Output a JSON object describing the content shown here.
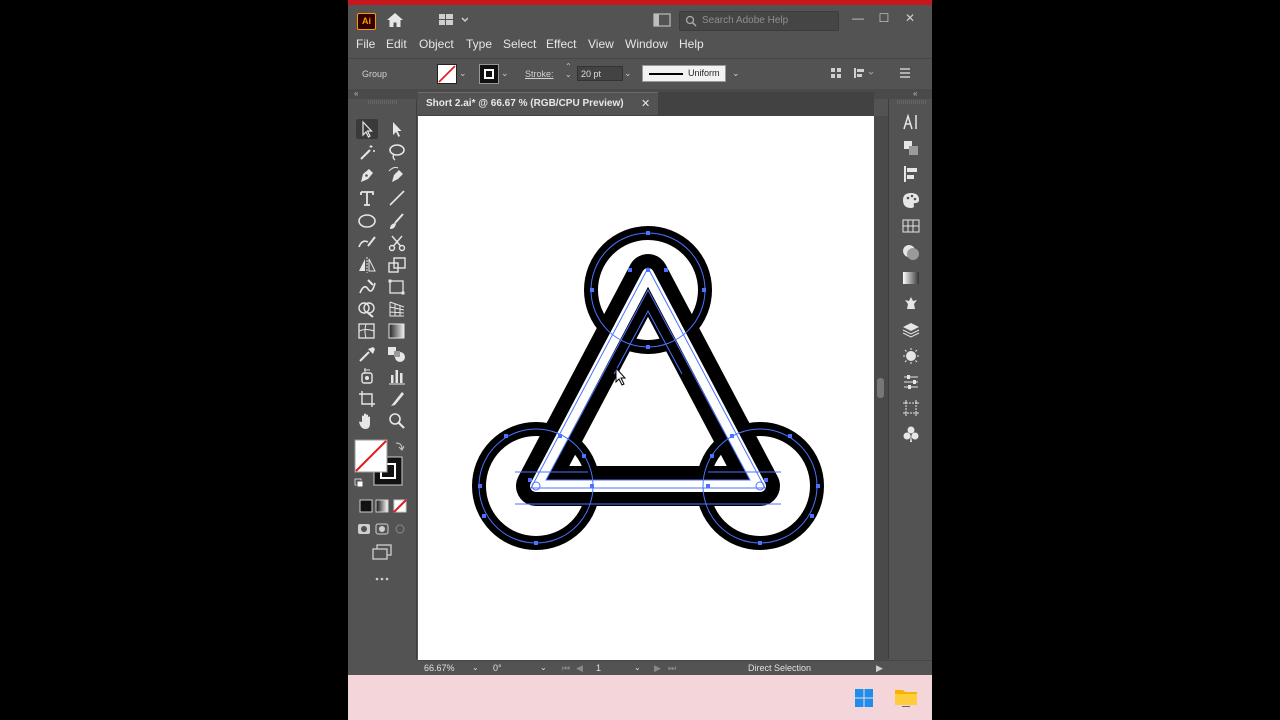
{
  "app": {
    "logo_text": "Ai",
    "search_placeholder": "Search Adobe Help",
    "window_buttons": [
      "—",
      "☐",
      "✕"
    ]
  },
  "menu": [
    "File",
    "Edit",
    "Object",
    "Type",
    "Select",
    "Effect",
    "View",
    "Window",
    "Help"
  ],
  "control_bar": {
    "selection_type": "Group",
    "stroke_label": "Stroke:",
    "stroke_value": "20 pt",
    "profile_label": "Uniform"
  },
  "ribbon": {
    "left_collapse": "«",
    "right_collapse": "«"
  },
  "document": {
    "tab_title": "Short 2.ai* @ 66.67 % (RGB/CPU Preview)",
    "close_symbol": "✕"
  },
  "status": {
    "zoom": "66.67%",
    "rotation": "0°",
    "artboard_number": "1",
    "tool": "Direct Selection"
  },
  "colors": {
    "app_bg": "#535353",
    "accent_top_line": "#c8161d",
    "selection_path": "#4a73ff",
    "taskbar_bg": "#f4d6da",
    "illustrator_orange": "#ff9a00"
  },
  "icons": {
    "tools": [
      "selection-tool",
      "direct-selection-tool",
      "magic-wand-tool",
      "lasso-tool",
      "pen-tool",
      "curvature-tool",
      "type-tool",
      "line-tool",
      "ellipse-tool",
      "paintbrush-tool",
      "shaper-tool",
      "scissors-tool",
      "reflect-tool",
      "scale-tool",
      "warp-tool",
      "free-transform-tool",
      "shape-builder-tool",
      "perspective-grid-tool",
      "mesh-tool",
      "gradient-tool",
      "eyedropper-tool",
      "blend-tool",
      "symbol-sprayer-tool",
      "column-graph-tool",
      "artboard-tool",
      "slice-tool",
      "hand-tool",
      "zoom-tool"
    ],
    "right_panels": [
      "character-icon",
      "transform-icon",
      "align-icon",
      "color-icon",
      "swatches-icon",
      "appearance-icon",
      "gradient-icon",
      "symbols-icon",
      "layers-icon",
      "brushes-icon",
      "properties-icon",
      "artboards-icon",
      "graphic-styles-icon"
    ]
  }
}
